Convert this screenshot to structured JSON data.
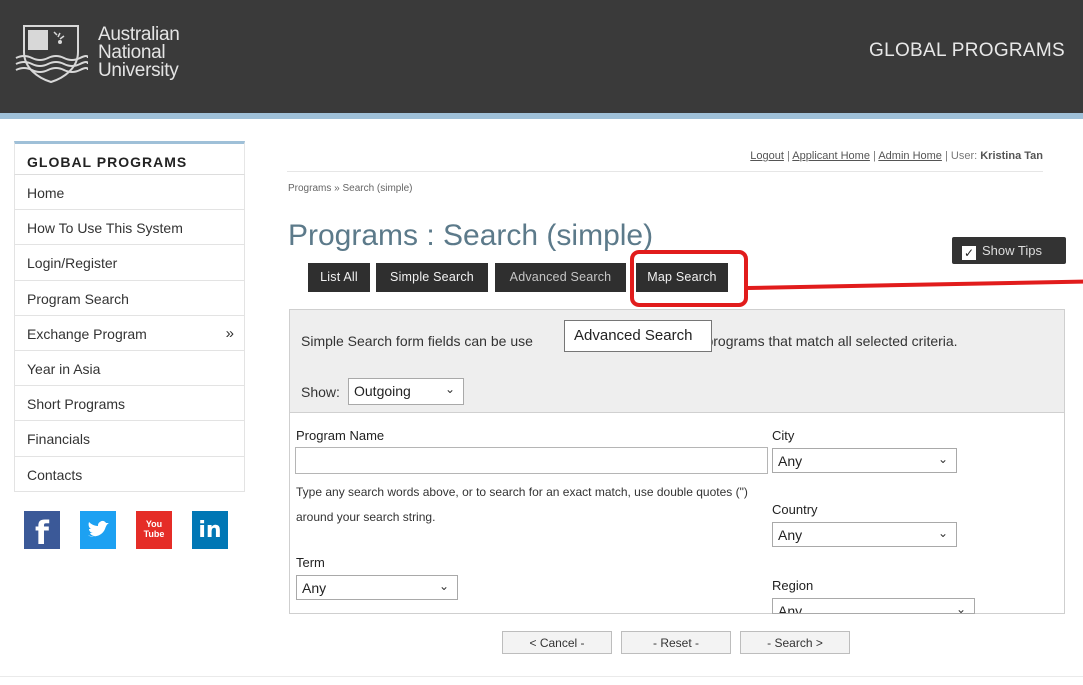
{
  "header": {
    "logo_lines": [
      "Australian",
      "National",
      "University"
    ],
    "title": "GLOBAL PROGRAMS",
    "bg_color": "#3a3a3a",
    "strip_color": "#9fc0d8"
  },
  "sidebar": {
    "title": "GLOBAL PROGRAMS",
    "items": [
      {
        "label": "Home"
      },
      {
        "label": "How To Use This System"
      },
      {
        "label": "Login/Register"
      },
      {
        "label": "Program Search"
      },
      {
        "label": "Exchange Program",
        "arrow": "»"
      },
      {
        "label": "Year in Asia"
      },
      {
        "label": "Short Programs"
      },
      {
        "label": "Financials"
      },
      {
        "label": "Contacts"
      }
    ],
    "social": [
      {
        "icon": "facebook-icon",
        "glyph": "f",
        "color": "#3b5998"
      },
      {
        "icon": "twitter-icon",
        "glyph": "t",
        "color": "#1da1f2"
      },
      {
        "icon": "youtube-icon",
        "glyph": "You Tube",
        "color": "#e52d27"
      },
      {
        "icon": "linkedin-icon",
        "glyph": "in",
        "color": "#0077b5"
      }
    ]
  },
  "toplinks": {
    "logout": "Logout",
    "applicant_home": "Applicant Home",
    "admin_home": "Admin Home",
    "user_label": "User:",
    "user_name": "Kristina Tan",
    "separator": "|"
  },
  "breadcrumb": "Programs » Search (simple)",
  "page_title": "Programs : Search (simple)",
  "show_tips": "Show Tips",
  "tabs": [
    {
      "label": "List All"
    },
    {
      "label": "Simple Search"
    },
    {
      "label": "Advanced Search"
    },
    {
      "label": "Map Search"
    }
  ],
  "highlight_color": "#e11c1c",
  "tooltip": "Advanced Search",
  "form": {
    "intro_before": "Simple Search form fields can be use",
    "intro_after": "ind programs that match all selected criteria.",
    "show_label": "Show:",
    "show_value": "Outgoing",
    "program_name_label": "Program Name",
    "program_name_value": "",
    "help_text": "Type any search words above, or to search for an exact match, use double quotes (\") around your search string.",
    "term_label": "Term",
    "term_value": "Any",
    "city_label": "City",
    "city_value": "Any",
    "country_label": "Country",
    "country_value": "Any",
    "region_label": "Region",
    "region_value": "Any"
  },
  "buttons": {
    "cancel": "< Cancel -",
    "reset": "- Reset -",
    "search": "- Search >"
  }
}
